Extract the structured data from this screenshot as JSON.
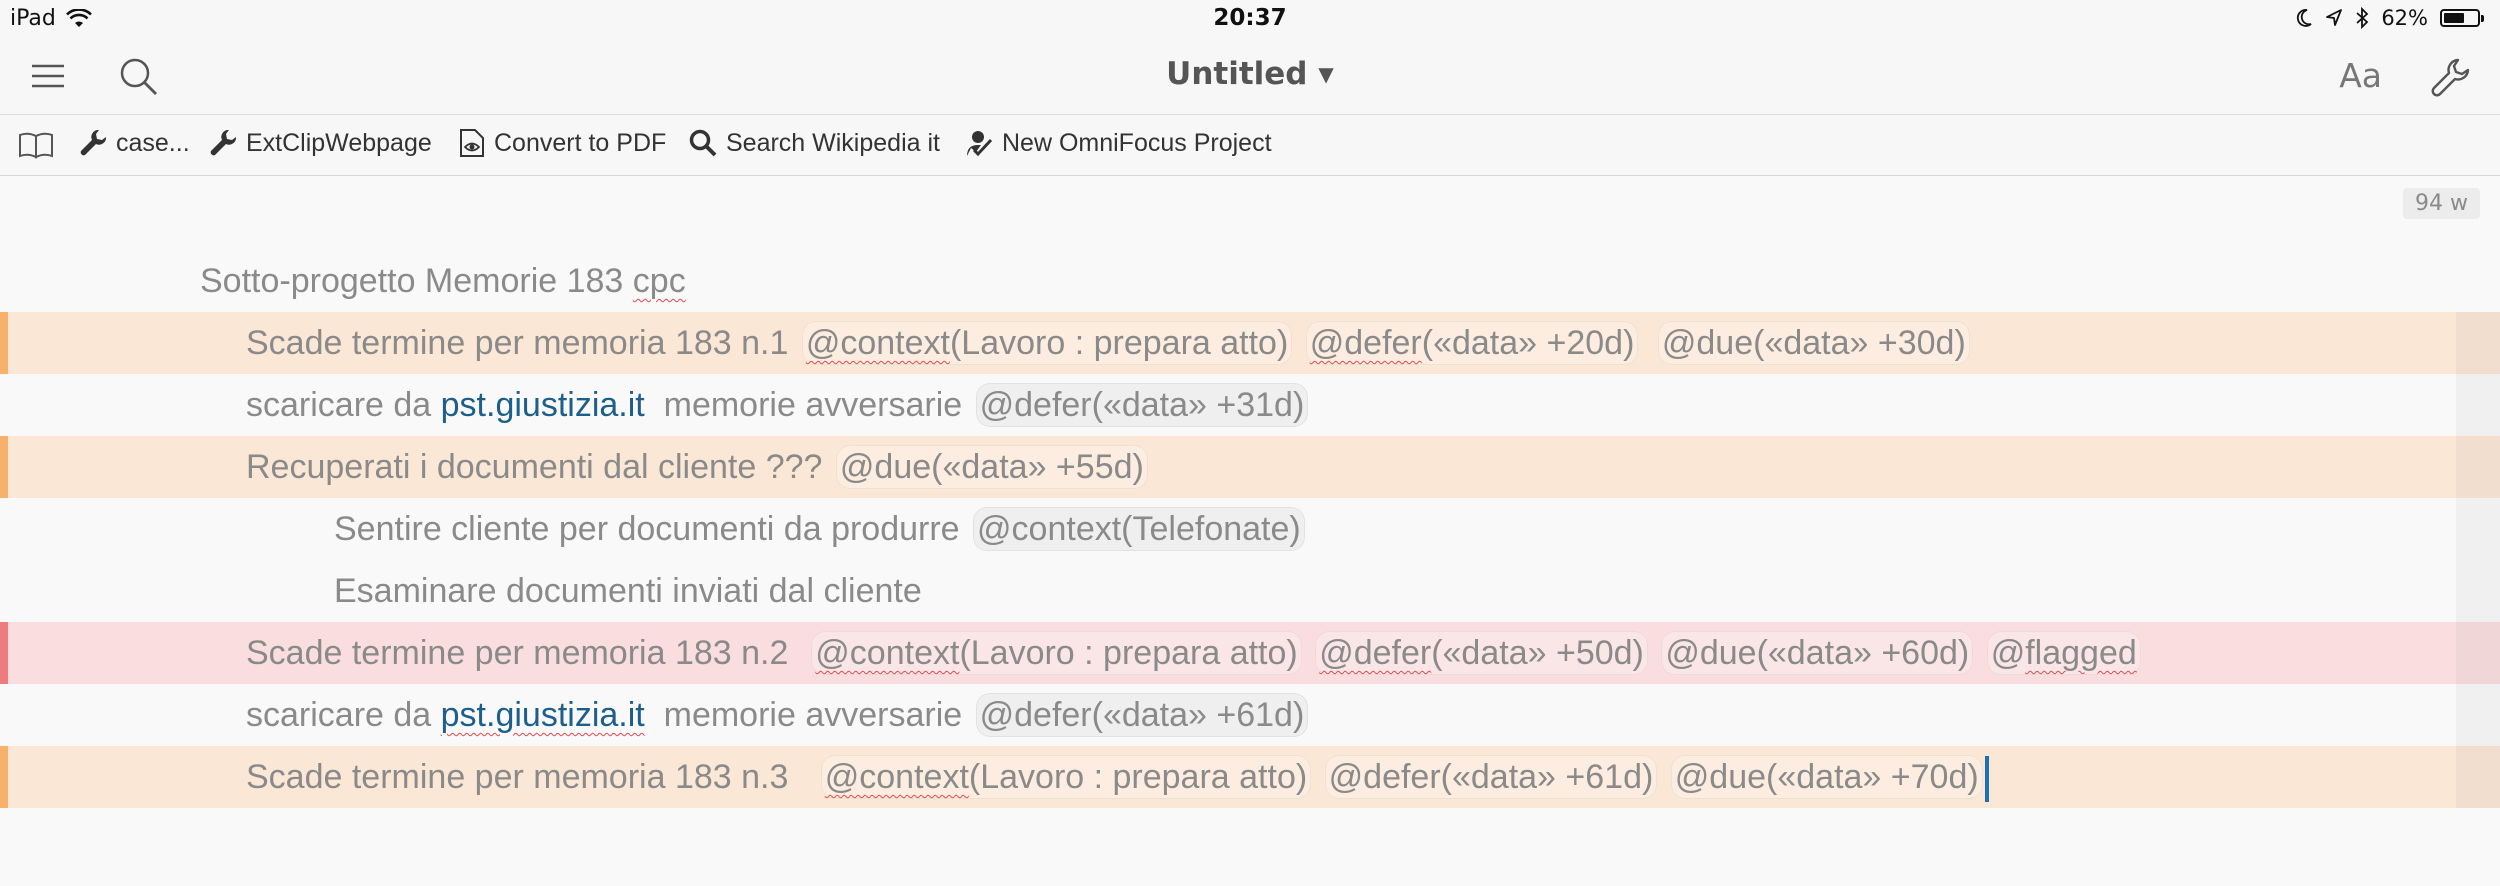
{
  "status": {
    "device": "iPad",
    "time": "20:37",
    "battery": "62%",
    "battery_level": 0.62
  },
  "nav": {
    "title": "Untitled ▾",
    "font_button": "Aa"
  },
  "toolbar": {
    "items": [
      {
        "label": "case...",
        "icon": "wrench-icon"
      },
      {
        "label": "ExtClipWebpage",
        "icon": "wrench-icon"
      },
      {
        "label": "Convert to PDF",
        "icon": "document-eye-icon"
      },
      {
        "label": "Search Wikipedia it",
        "icon": "search-icon"
      },
      {
        "label": "New OmniFocus Project",
        "icon": "omnifocus-icon"
      }
    ]
  },
  "word_count": "94 w",
  "lines": {
    "l0": {
      "pre": "Sotto-progetto Memorie 183 ",
      "err": "cpc"
    },
    "l1": {
      "text": "Scade termine per memoria 183 n.1",
      "t1a": "@context",
      "t1b": "(Lavoro : prepara atto)",
      "t2a": "@defer",
      "t2b": "(«data» +20d)",
      "t3": "@due(«data» +30d)"
    },
    "l2": {
      "pre": "scaricare da ",
      "link": "pst.giustizia.it",
      "post": "  memorie avversarie",
      "t1": "@defer(«data» +31d)"
    },
    "l3": {
      "text": "Recuperati i documenti dal cliente ???",
      "t1": "@due(«data» +55d)"
    },
    "l4": {
      "text": "Sentire cliente per documenti da produrre",
      "t1": "@context(Telefonate)"
    },
    "l5": {
      "text": "Esaminare documenti inviati dal cliente"
    },
    "l6": {
      "text": "Scade termine per memoria 183 n.2 ",
      "t1a": "@context",
      "t1b": "(Lavoro : prepara atto)",
      "t2a": "@defer",
      "t2b": "(«data» +50d)",
      "t3": "@due(«data» +60d)",
      "t4a": "@",
      "t4b": "flagged"
    },
    "l7": {
      "pre": "scaricare da ",
      "link": "pst.giustizia.it",
      "post": "  memorie avversarie",
      "t1": "@defer(«data» +61d)"
    },
    "l8": {
      "text": "Scade termine per memoria 183 n.3  ",
      "t1a": "@context",
      "t1b": "(Lavoro : prepara atto)",
      "t2": "@defer(«data» +61d)",
      "t3": "@due(«data» +70d)"
    }
  }
}
